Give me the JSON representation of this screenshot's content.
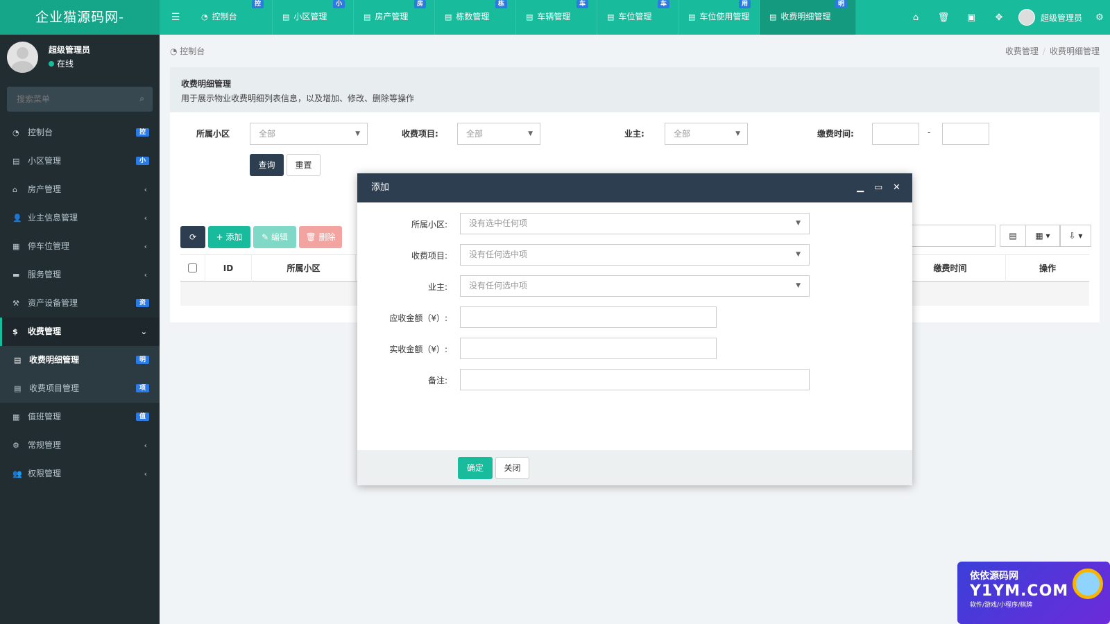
{
  "app": {
    "logo": "企业猫源码网-",
    "menu_toggle_icon": "bars-icon"
  },
  "topnav": [
    {
      "label": "控制台",
      "tag": "控",
      "icon": "dashboard-icon"
    },
    {
      "label": "小区管理",
      "tag": "小",
      "icon": "list-icon"
    },
    {
      "label": "房产管理",
      "tag": "房",
      "icon": "list-icon"
    },
    {
      "label": "栋数管理",
      "tag": "栋",
      "icon": "list-icon"
    },
    {
      "label": "车辆管理",
      "tag": "车",
      "icon": "list-icon"
    },
    {
      "label": "车位管理",
      "tag": "车",
      "icon": "list-icon"
    },
    {
      "label": "车位使用管理",
      "tag": "用",
      "icon": "list-icon"
    },
    {
      "label": "收费明细管理",
      "tag": "明",
      "icon": "list-icon",
      "active": true
    }
  ],
  "topright": {
    "user": "超级管理员",
    "icons": [
      "home-icon",
      "trash-icon",
      "language-icon",
      "fullscreen-icon",
      "settings-icon"
    ]
  },
  "sidebar": {
    "user_name": "超级管理员",
    "status": "在线",
    "search_placeholder": "搜索菜单",
    "items": [
      {
        "label": "控制台",
        "badge": "控"
      },
      {
        "label": "小区管理",
        "badge": "小"
      },
      {
        "label": "房产管理",
        "arrow": "‹"
      },
      {
        "label": "业主信息管理",
        "arrow": "‹"
      },
      {
        "label": "停车位管理",
        "arrow": "‹"
      },
      {
        "label": "服务管理",
        "arrow": "‹"
      },
      {
        "label": "资产设备管理",
        "badge": "资"
      },
      {
        "label": "收费管理",
        "arrow": "⌄",
        "open": true
      },
      {
        "label": "收费明细管理",
        "badge": "明",
        "sub": true,
        "current": true
      },
      {
        "label": "收费项目管理",
        "badge": "项",
        "sub": true
      },
      {
        "label": "值班管理",
        "badge": "值"
      },
      {
        "label": "常规管理",
        "arrow": "‹"
      },
      {
        "label": "权限管理",
        "arrow": "‹"
      }
    ]
  },
  "breadcrumb": {
    "left": "控制台",
    "right": [
      "收费管理",
      "收费明细管理"
    ]
  },
  "panel": {
    "title": "收费明细管理",
    "desc": "用于展示物业收费明细列表信息，以及增加、修改、删除等操作"
  },
  "filters": {
    "community_label": "所属小区",
    "community_value": "全部",
    "item_label": "收费项目:",
    "item_value": "全部",
    "owner_label": "业主:",
    "owner_value": "全部",
    "time_label": "缴费时间:",
    "time_sep": "-",
    "query": "查询",
    "reset": "重置"
  },
  "toolbar": {
    "refresh_icon": "refresh-icon",
    "add": "+ 添加",
    "edit": "✎ 编辑",
    "delete": "🗑 删除"
  },
  "table": {
    "headers": [
      "ID",
      "所属小区",
      "缴费时间",
      "操作"
    ]
  },
  "modal": {
    "title": "添加",
    "fields": [
      {
        "label": "所属小区:",
        "placeholder": "没有选中任何项",
        "type": "select"
      },
      {
        "label": "收费项目:",
        "placeholder": "没有任何选中项",
        "type": "select"
      },
      {
        "label": "业主:",
        "placeholder": "没有任何选中项",
        "type": "select"
      },
      {
        "label": "应收金额（¥）:",
        "type": "input"
      },
      {
        "label": "实收金额（¥）:",
        "type": "input"
      },
      {
        "label": "备注:",
        "type": "input"
      }
    ],
    "ok": "确定",
    "close": "关闭"
  },
  "watermark": {
    "line1": "依依源码网",
    "line2": "Y1YM.COM",
    "line3": "软件/游戏/小程序/棋牌"
  }
}
